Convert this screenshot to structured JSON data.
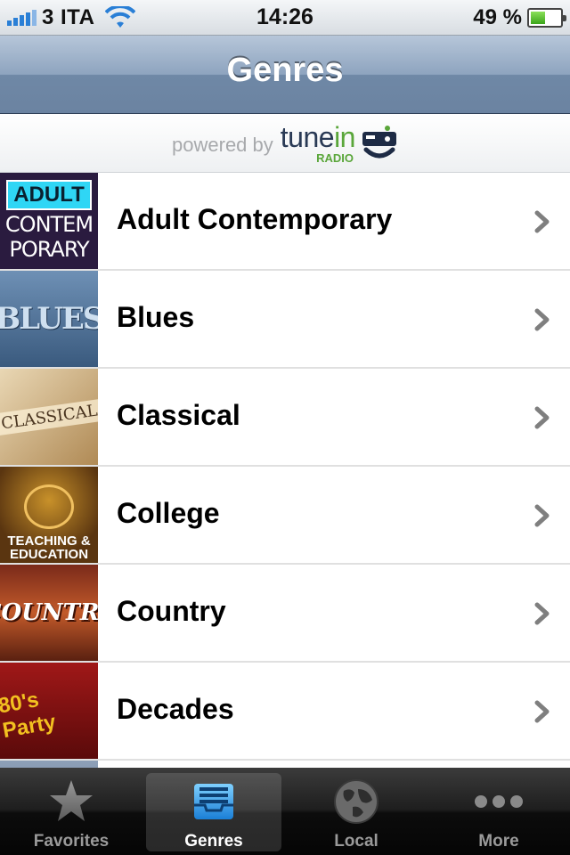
{
  "status_bar": {
    "carrier": "3 ITA",
    "time": "14:26",
    "battery": "49 %",
    "battery_level": 0.49
  },
  "nav": {
    "title": "Genres"
  },
  "banner": {
    "powered_by": "powered by",
    "brand_main_a": "tune",
    "brand_main_b": "in",
    "brand_sub": "RADIO"
  },
  "genres": [
    {
      "label": "Adult Contemporary",
      "thumb_text": [
        "ADULT",
        "CONTEM",
        "PORARY"
      ]
    },
    {
      "label": "Blues",
      "thumb_text": "BLUES"
    },
    {
      "label": "Classical",
      "thumb_text": "CLASSICAL"
    },
    {
      "label": "College",
      "thumb_text": [
        "TEACHING &",
        "EDUCATION"
      ]
    },
    {
      "label": "Country",
      "thumb_text": "COUNTRY"
    },
    {
      "label": "Decades",
      "thumb_text": "80's Party"
    }
  ],
  "tabs": [
    {
      "label": "Favorites",
      "icon": "star-icon",
      "active": false
    },
    {
      "label": "Genres",
      "icon": "inbox-tray-icon",
      "active": true
    },
    {
      "label": "Local",
      "icon": "globe-icon",
      "active": false
    },
    {
      "label": "More",
      "icon": "more-dots-icon",
      "active": false
    }
  ]
}
